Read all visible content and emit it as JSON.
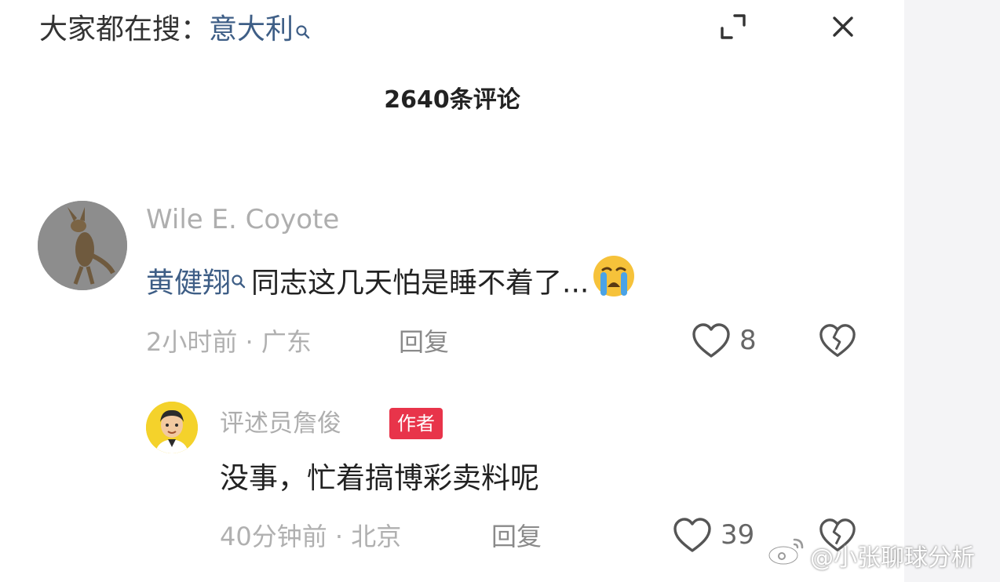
{
  "search_hint": {
    "prefix": "大家都在搜：",
    "term": "意大利"
  },
  "header": {
    "comment_count": "2640条评论"
  },
  "comments": [
    {
      "username": "Wile E. Coyote",
      "mention": "黄健翔",
      "text": "同志这几天怕是睡不着了...",
      "time": "2小时前",
      "location": "广东",
      "meta_separator": " · ",
      "reply_label": "回复",
      "likes": "8"
    },
    {
      "username": "评述员詹俊",
      "badge": "作者",
      "text": "没事，忙着搞博彩卖料呢",
      "time": "40分钟前",
      "location": "北京",
      "meta_separator": " · ",
      "reply_label": "回复",
      "likes": "39"
    }
  ],
  "watermark": {
    "text": "@小张聊球分析"
  },
  "icons": {
    "search": "search-icon",
    "collapse": "collapse-icon",
    "close": "close-icon",
    "like": "heart-icon",
    "dislike": "broken-heart-icon",
    "emoji": "crying-face-emoji",
    "weibo": "weibo-logo-icon"
  },
  "colors": {
    "mention_blue": "#3e5e86",
    "badge_red": "#e8344a",
    "muted_gray": "#b0b0b0"
  }
}
